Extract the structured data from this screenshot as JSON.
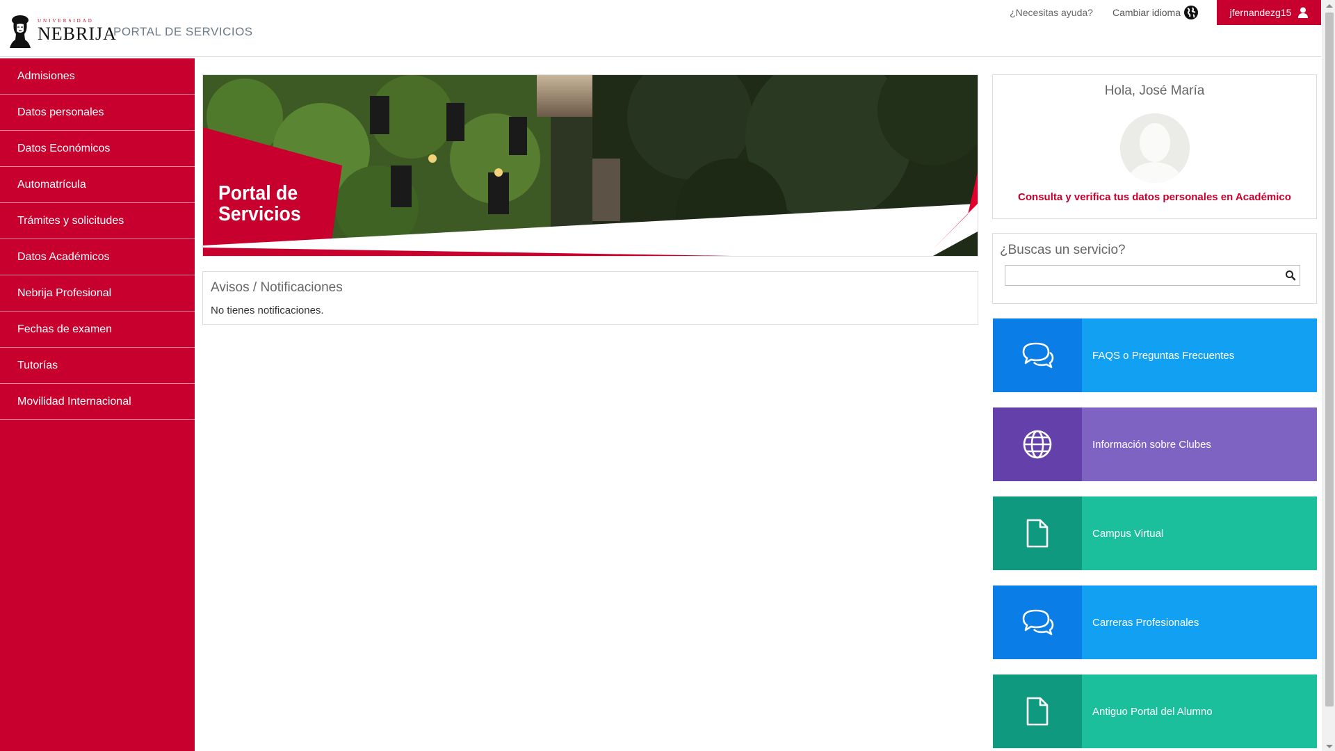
{
  "header": {
    "logo_small": "UNIVERSIDAD",
    "logo_big": "NEBRIJA",
    "portal_title": "PORTAL DE SERVICIOS",
    "help_label": "¿Necesitas ayuda?",
    "language_label": "Cambiar idioma",
    "username": "jfernandezg15"
  },
  "sidebar": {
    "items": [
      {
        "label": "Admisiones"
      },
      {
        "label": "Datos personales"
      },
      {
        "label": "Datos Económicos"
      },
      {
        "label": "Automatrícula"
      },
      {
        "label": "Trámites y solicitudes"
      },
      {
        "label": "Datos Académicos"
      },
      {
        "label": "Nebrija Profesional"
      },
      {
        "label": "Fechas de examen"
      },
      {
        "label": "Tutorías"
      },
      {
        "label": "Movilidad Internacional"
      }
    ]
  },
  "banner": {
    "title_line1": "Portal de",
    "title_line2": "Servicios"
  },
  "notifications": {
    "title": "Avisos / Notificaciones",
    "empty_text": "No tienes notificaciones."
  },
  "profile": {
    "greeting": "Hola, José María",
    "verify_link": "Consulta y verifica tus datos personales en Académico"
  },
  "search": {
    "title": "¿Buscas un servicio?",
    "value": "",
    "placeholder": ""
  },
  "tiles": [
    {
      "label": "FAQS o Preguntas Frecuentes",
      "icon": "chat-icon",
      "icon_bg": "#0a7ee6",
      "bg": "#12a0f2"
    },
    {
      "label": "Información sobre Clubes",
      "icon": "globe-icon",
      "icon_bg": "#6441aa",
      "bg": "#7f63c2"
    },
    {
      "label": "Campus Virtual",
      "icon": "document-icon",
      "icon_bg": "#0f9a80",
      "bg": "#1bbf9c"
    },
    {
      "label": "Carreras Profesionales",
      "icon": "chat-icon",
      "icon_bg": "#0a7ee6",
      "bg": "#12a0f2"
    },
    {
      "label": "Antiguo Portal del Alumno",
      "icon": "document-icon",
      "icon_bg": "#0f9a80",
      "bg": "#1bbf9c"
    }
  ],
  "colors": {
    "brand_red": "#c8002d"
  }
}
